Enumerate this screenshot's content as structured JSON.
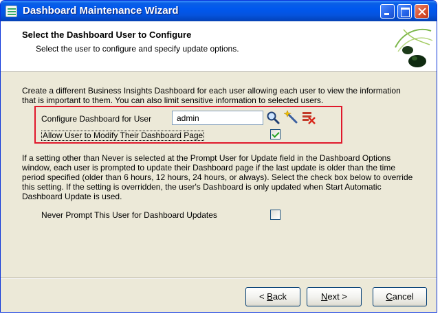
{
  "window": {
    "title": "Dashboard Maintenance Wizard"
  },
  "header": {
    "title": "Select the Dashboard User to Configure",
    "subtitle": "Select the user to configure and specify update options."
  },
  "main": {
    "description1": "Create a different Business Insights Dashboard for each user allowing each user to view the information that is important to them.  You can also limit sensitive information to selected users.",
    "configure_user_label": "Configure Dashboard for User",
    "configure_user_value": "admin",
    "allow_modify_label": "Allow User to Modify Their Dashboard Page",
    "allow_modify_checked": true,
    "description2": "If a setting other than Never is selected at the Prompt User for Update field in the Dashboard Options window, each user is prompted to update their Dashboard page if the last update is older than the time period specified (older than 6 hours, 12 hours, 24 hours, or always).  Select the check box below to override this setting.  If the setting is overridden, the user's Dashboard is only updated when Start Automatic Dashboard Update is used.",
    "never_prompt_label": "Never Prompt This User for Dashboard Updates",
    "never_prompt_checked": false
  },
  "buttons": {
    "back_prefix": "< ",
    "back_key": "B",
    "back_rest": "ack",
    "next_prefix": "",
    "next_key": "N",
    "next_rest": "ext >",
    "cancel_prefix": "",
    "cancel_key": "C",
    "cancel_rest": "ancel"
  },
  "icons": {
    "app": "dashboard-app-icon",
    "search": "magnifier-icon",
    "wand": "wand-icon",
    "delete": "delete-icon",
    "logo": "leaf-logo-icon"
  },
  "colors": {
    "highlight_border": "#e0182b",
    "titlebar": "#0553dd",
    "dialog_bg": "#ece9d8"
  }
}
